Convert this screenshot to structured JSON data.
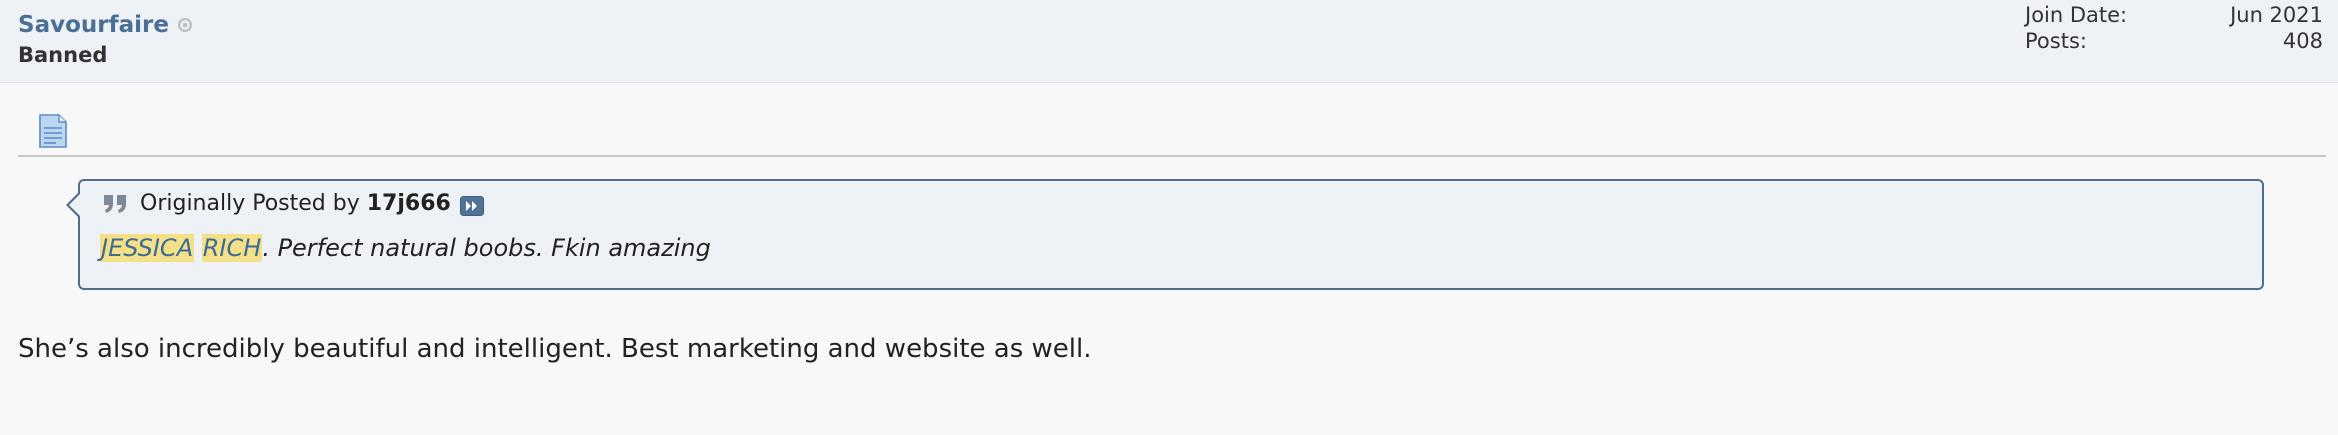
{
  "user": {
    "name": "Savourfaire",
    "title": "Banned"
  },
  "stats": {
    "join_date_label": "Join Date:",
    "join_date_value": "Jun 2021",
    "posts_label": "Posts:",
    "posts_value": "408"
  },
  "quote": {
    "prefix": "Originally Posted by",
    "poster": "17j666",
    "highlight_1": "JESSICA",
    "highlight_2": "RICH",
    "rest": ". Perfect natural boobs. Fkin amazing"
  },
  "post": {
    "message": "She’s also incredibly beautiful and intelligent. Best marketing and website as well."
  },
  "colors": {
    "username": "#4a6f95",
    "quote_border": "#4e6f8f",
    "highlight": "#f5e08a"
  },
  "icons": [
    "user-offline-icon",
    "post-document-icon",
    "quote-marks-icon",
    "view-post-icon"
  ]
}
